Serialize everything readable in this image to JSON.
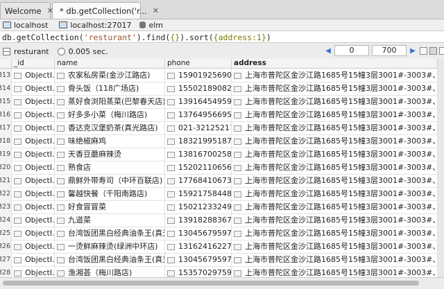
{
  "tabs": [
    {
      "label": "Welcome",
      "close": "✕"
    },
    {
      "label": "* db.getCollection('r...",
      "close": "✕"
    }
  ],
  "connection": {
    "host": "localhost",
    "server": "localhost:27017",
    "db": "elm"
  },
  "query": {
    "prefix": "db.getCollection(",
    "collection": "'resturant'",
    "middle": ").find(",
    "find_arg": "{}",
    "sort_open": ").sort(",
    "sort_arg": "{address:1}",
    "suffix": ")"
  },
  "results": {
    "collection": "resturant",
    "time": "0.005 sec.",
    "skip": "0",
    "limit": "700"
  },
  "columns": [
    "_id",
    "name",
    "phone",
    "address"
  ],
  "rows": [
    {
      "num": "313",
      "id": "ObjectI...",
      "name": "农家私房菜(金沙江路店)",
      "phone": "15901925690",
      "address": "上海市普陀区金沙江路1685号15幢3层3001#-3003#、3005#-30"
    },
    {
      "num": "314",
      "id": "ObjectI...",
      "name": "骨头饭（118广场店)",
      "phone": "15502189082 1...",
      "address": "上海市普陀区金沙江路1685号15幢3层3001#-3003#、3005#-30"
    },
    {
      "num": "315",
      "id": "ObjectI...",
      "name": "蒸好食浏阳蒸菜(巴黎春天店)",
      "phone": "13916454959 1...",
      "address": "上海市普陀区金沙江路1685号15幢3层3001#-3003#、3005#-30"
    },
    {
      "num": "316",
      "id": "ObjectI...",
      "name": "好多多小菜（梅川路店)",
      "phone": "13764956695",
      "address": "上海市普陀区金沙江路1685号15幢3层3001#-3003#、3005#-30"
    },
    {
      "num": "317",
      "id": "ObjectI...",
      "name": "香达克汉堡奶茶(真光路店)",
      "phone": "021-32125217",
      "address": "上海市普陀区金沙江路1685号15幢3层3001#-3003#、3005#-30"
    },
    {
      "num": "318",
      "id": "ObjectI...",
      "name": "味绝椒麻鸡",
      "phone": "18321995187",
      "address": "上海市普陀区金沙江路1685号15幢3层3001#-3003#、3005#-30"
    },
    {
      "num": "319",
      "id": "ObjectI...",
      "name": "天香豆蘑麻辣烫",
      "phone": "13816700258",
      "address": "上海市普陀区金沙江路1685号15幢3层3001#-3003#、3005#-30"
    },
    {
      "num": "320",
      "id": "ObjectI...",
      "name": "熟食店",
      "phone": "15202110656",
      "address": "上海市普陀区金沙江路1685号15幢3层3001#-3003#、3005#-30"
    },
    {
      "num": "321",
      "id": "ObjectI...",
      "name": "鼎鲜外带寿司（中环百联店)",
      "phone": "17768410673",
      "address": "上海市普陀区金沙江路1685号15幢3层3001#-3003#、3005#-30"
    },
    {
      "num": "322",
      "id": "ObjectI...",
      "name": "馨越快餐（千阳南路店)",
      "phone": "15921758448",
      "address": "上海市普陀区金沙江路1685号15幢3层3001#-3003#、3005#-30"
    },
    {
      "num": "323",
      "id": "ObjectI...",
      "name": "好食冒冒菜",
      "phone": "15021233249 1...",
      "address": "上海市普陀区金沙江路1685号15幢3层3001#-3003#、3005#-30"
    },
    {
      "num": "324",
      "id": "ObjectI...",
      "name": "九道菜",
      "phone": "13918288367",
      "address": "上海市普陀区金沙江路1685号15幢3层3001#-3003#、3005#-30"
    },
    {
      "num": "325",
      "id": "ObjectI...",
      "name": "台湾饭团黑白经典油条王(真光...",
      "phone": "13045679597",
      "address": "上海市普陀区金沙江路1685号15幢3层3001#-3003#、3005#-30"
    },
    {
      "num": "326",
      "id": "ObjectI...",
      "name": "一烫鲜麻辣烫(绿洲中环店)",
      "phone": "13162416227",
      "address": "上海市普陀区金沙江路1685号15幢3层3001#-3003#、3005#-30"
    },
    {
      "num": "327",
      "id": "ObjectI...",
      "name": "台湾饭团黑白经典油条王(真光...",
      "phone": "13045679597",
      "address": "上海市普陀区金沙江路1685号15幢3层3001#-3003#、3005#-30"
    },
    {
      "num": "328",
      "id": "ObjectI...",
      "name": "渔湘荟（梅川路店)",
      "phone": "15357029759",
      "address": "上海市普陀区金沙江路1685号15幢3层3001#-3003#、3005#-30"
    }
  ]
}
